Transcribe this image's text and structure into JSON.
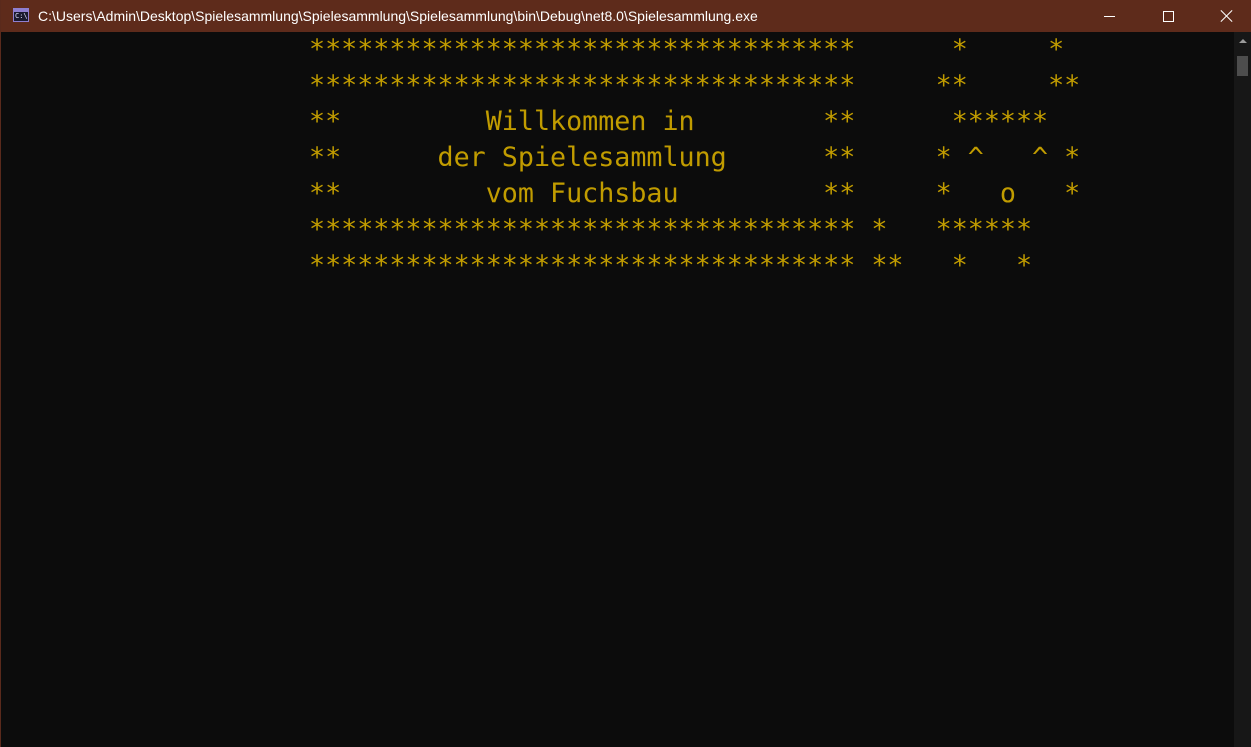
{
  "window": {
    "title": "C:\\Users\\Admin\\Desktop\\Spielesammlung\\Spielesammlung\\Spielesammlung\\bin\\Debug\\net8.0\\Spielesammlung.exe",
    "icon": "console-app-icon",
    "icon_text": "C:\\",
    "titlebar_color": "#5e2b1b"
  },
  "controls": {
    "minimize_icon": "minimize-icon",
    "maximize_icon": "maximize-icon",
    "close_icon": "close-icon"
  },
  "console": {
    "text_color": "#c19c00",
    "background": "#0c0c0c",
    "lines": [
      "**********************************      *     *",
      "**********************************     **     **",
      "**         Willkommen in        **      ******",
      "**      der Spielesammlung      **     * ^   ^ *",
      "**         vom Fuchsbau         **     *   o   *",
      "********************************** *   ******",
      "********************************** **   *   *"
    ]
  }
}
